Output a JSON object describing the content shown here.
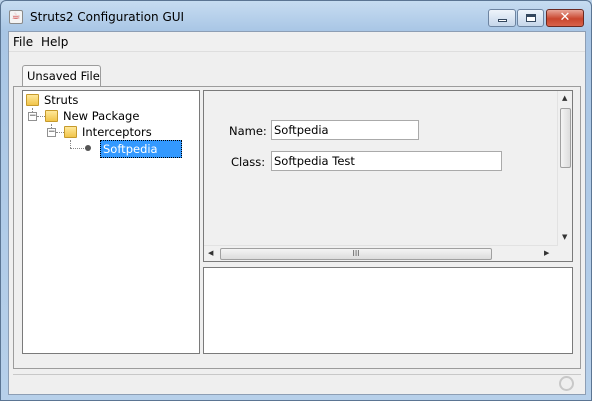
{
  "window": {
    "title": "Struts2 Configuration GUI",
    "icon": "java-icon",
    "controls": [
      "minimize-icon",
      "maximize-icon",
      "close-icon"
    ],
    "close_glyph": "✕"
  },
  "menubar": {
    "items": [
      {
        "label": "File"
      },
      {
        "label": "Help"
      }
    ]
  },
  "tabs": [
    {
      "label": "Unsaved File",
      "selected": true
    }
  ],
  "tree": {
    "nodes": [
      {
        "label": "Struts",
        "icon": "folder-icon",
        "expanded": true
      },
      {
        "label": "New Package",
        "icon": "folder-icon",
        "expanded": true,
        "toggle": "−"
      },
      {
        "label": "Interceptors",
        "icon": "folder-icon",
        "expanded": true,
        "toggle": "−"
      },
      {
        "label": "Softpedia",
        "icon": "leaf-icon",
        "selected": true
      }
    ]
  },
  "form": {
    "name_label": "Name:",
    "name_value": "Softpedia",
    "class_label": "Class:",
    "class_value": "Softpedia Test",
    "scroll_grip": "III"
  },
  "colors": {
    "selection": "#3399ff",
    "close_button": "#c9462e"
  }
}
